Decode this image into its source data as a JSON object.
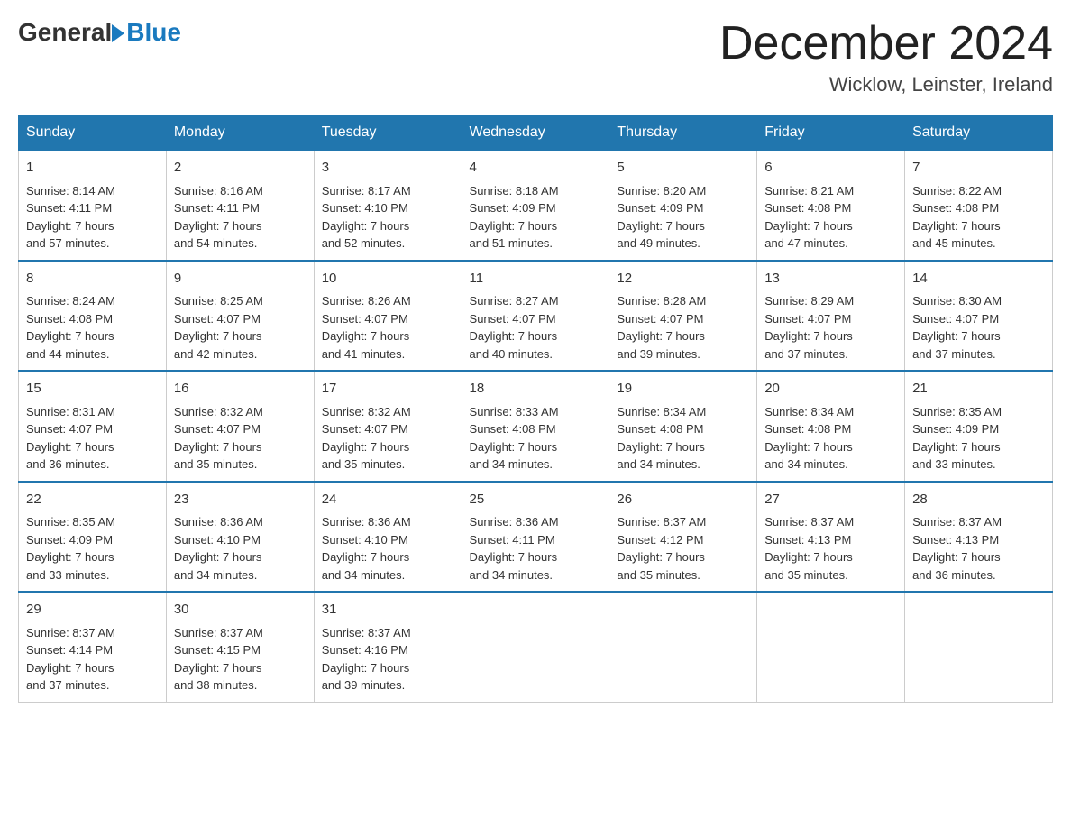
{
  "logo": {
    "general": "General",
    "blue": "Blue"
  },
  "title": "December 2024",
  "location": "Wicklow, Leinster, Ireland",
  "days_of_week": [
    "Sunday",
    "Monday",
    "Tuesday",
    "Wednesday",
    "Thursday",
    "Friday",
    "Saturday"
  ],
  "weeks": [
    [
      {
        "day": "1",
        "sunrise": "8:14 AM",
        "sunset": "4:11 PM",
        "daylight": "7 hours and 57 minutes."
      },
      {
        "day": "2",
        "sunrise": "8:16 AM",
        "sunset": "4:11 PM",
        "daylight": "7 hours and 54 minutes."
      },
      {
        "day": "3",
        "sunrise": "8:17 AM",
        "sunset": "4:10 PM",
        "daylight": "7 hours and 52 minutes."
      },
      {
        "day": "4",
        "sunrise": "8:18 AM",
        "sunset": "4:09 PM",
        "daylight": "7 hours and 51 minutes."
      },
      {
        "day": "5",
        "sunrise": "8:20 AM",
        "sunset": "4:09 PM",
        "daylight": "7 hours and 49 minutes."
      },
      {
        "day": "6",
        "sunrise": "8:21 AM",
        "sunset": "4:08 PM",
        "daylight": "7 hours and 47 minutes."
      },
      {
        "day": "7",
        "sunrise": "8:22 AM",
        "sunset": "4:08 PM",
        "daylight": "7 hours and 45 minutes."
      }
    ],
    [
      {
        "day": "8",
        "sunrise": "8:24 AM",
        "sunset": "4:08 PM",
        "daylight": "7 hours and 44 minutes."
      },
      {
        "day": "9",
        "sunrise": "8:25 AM",
        "sunset": "4:07 PM",
        "daylight": "7 hours and 42 minutes."
      },
      {
        "day": "10",
        "sunrise": "8:26 AM",
        "sunset": "4:07 PM",
        "daylight": "7 hours and 41 minutes."
      },
      {
        "day": "11",
        "sunrise": "8:27 AM",
        "sunset": "4:07 PM",
        "daylight": "7 hours and 40 minutes."
      },
      {
        "day": "12",
        "sunrise": "8:28 AM",
        "sunset": "4:07 PM",
        "daylight": "7 hours and 39 minutes."
      },
      {
        "day": "13",
        "sunrise": "8:29 AM",
        "sunset": "4:07 PM",
        "daylight": "7 hours and 37 minutes."
      },
      {
        "day": "14",
        "sunrise": "8:30 AM",
        "sunset": "4:07 PM",
        "daylight": "7 hours and 37 minutes."
      }
    ],
    [
      {
        "day": "15",
        "sunrise": "8:31 AM",
        "sunset": "4:07 PM",
        "daylight": "7 hours and 36 minutes."
      },
      {
        "day": "16",
        "sunrise": "8:32 AM",
        "sunset": "4:07 PM",
        "daylight": "7 hours and 35 minutes."
      },
      {
        "day": "17",
        "sunrise": "8:32 AM",
        "sunset": "4:07 PM",
        "daylight": "7 hours and 35 minutes."
      },
      {
        "day": "18",
        "sunrise": "8:33 AM",
        "sunset": "4:08 PM",
        "daylight": "7 hours and 34 minutes."
      },
      {
        "day": "19",
        "sunrise": "8:34 AM",
        "sunset": "4:08 PM",
        "daylight": "7 hours and 34 minutes."
      },
      {
        "day": "20",
        "sunrise": "8:34 AM",
        "sunset": "4:08 PM",
        "daylight": "7 hours and 34 minutes."
      },
      {
        "day": "21",
        "sunrise": "8:35 AM",
        "sunset": "4:09 PM",
        "daylight": "7 hours and 33 minutes."
      }
    ],
    [
      {
        "day": "22",
        "sunrise": "8:35 AM",
        "sunset": "4:09 PM",
        "daylight": "7 hours and 33 minutes."
      },
      {
        "day": "23",
        "sunrise": "8:36 AM",
        "sunset": "4:10 PM",
        "daylight": "7 hours and 34 minutes."
      },
      {
        "day": "24",
        "sunrise": "8:36 AM",
        "sunset": "4:10 PM",
        "daylight": "7 hours and 34 minutes."
      },
      {
        "day": "25",
        "sunrise": "8:36 AM",
        "sunset": "4:11 PM",
        "daylight": "7 hours and 34 minutes."
      },
      {
        "day": "26",
        "sunrise": "8:37 AM",
        "sunset": "4:12 PM",
        "daylight": "7 hours and 35 minutes."
      },
      {
        "day": "27",
        "sunrise": "8:37 AM",
        "sunset": "4:13 PM",
        "daylight": "7 hours and 35 minutes."
      },
      {
        "day": "28",
        "sunrise": "8:37 AM",
        "sunset": "4:13 PM",
        "daylight": "7 hours and 36 minutes."
      }
    ],
    [
      {
        "day": "29",
        "sunrise": "8:37 AM",
        "sunset": "4:14 PM",
        "daylight": "7 hours and 37 minutes."
      },
      {
        "day": "30",
        "sunrise": "8:37 AM",
        "sunset": "4:15 PM",
        "daylight": "7 hours and 38 minutes."
      },
      {
        "day": "31",
        "sunrise": "8:37 AM",
        "sunset": "4:16 PM",
        "daylight": "7 hours and 39 minutes."
      },
      null,
      null,
      null,
      null
    ]
  ],
  "labels": {
    "sunrise": "Sunrise:",
    "sunset": "Sunset:",
    "daylight": "Daylight:"
  }
}
